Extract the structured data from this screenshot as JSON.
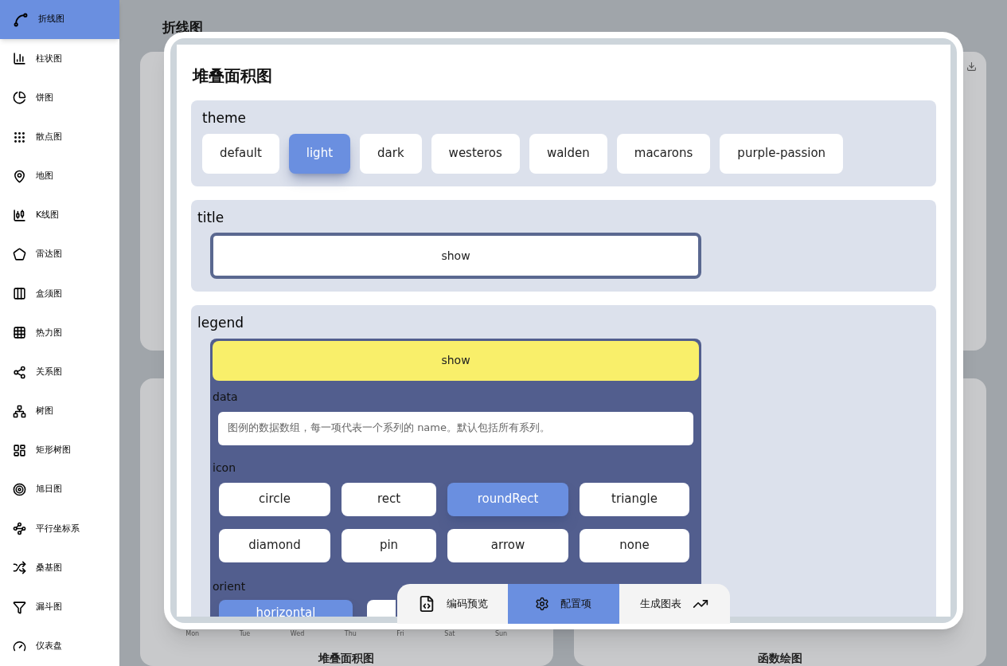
{
  "sidebar": {
    "items": [
      {
        "label": "折线图",
        "selected": true
      },
      {
        "label": "柱状图",
        "selected": false
      },
      {
        "label": "饼图",
        "selected": false
      },
      {
        "label": "散点图",
        "selected": false
      },
      {
        "label": "地图",
        "selected": false
      },
      {
        "label": "K线图",
        "selected": false
      },
      {
        "label": "雷达图",
        "selected": false
      },
      {
        "label": "盒须图",
        "selected": false
      },
      {
        "label": "热力图",
        "selected": false
      },
      {
        "label": "关系图",
        "selected": false
      },
      {
        "label": "树图",
        "selected": false
      },
      {
        "label": "矩形树图",
        "selected": false
      },
      {
        "label": "旭日图",
        "selected": false
      },
      {
        "label": "平行坐标系",
        "selected": false
      },
      {
        "label": "桑基图",
        "selected": false
      },
      {
        "label": "漏斗图",
        "selected": false
      },
      {
        "label": "仪表盘",
        "selected": false
      }
    ]
  },
  "page": {
    "title": "折线图",
    "cards": [
      {
        "title": "堆叠面积图",
        "x_labels": [
          "Mon",
          "Tue",
          "Wed",
          "Thu",
          "Fri",
          "Sat",
          "Sun"
        ]
      },
      {
        "title": "函数绘图"
      }
    ]
  },
  "dialog": {
    "title": "堆叠面积图",
    "theme": {
      "label": "theme",
      "options": [
        {
          "label": "default",
          "selected": false
        },
        {
          "label": "light",
          "selected": true
        },
        {
          "label": "dark",
          "selected": false
        },
        {
          "label": "westeros",
          "selected": false
        },
        {
          "label": "walden",
          "selected": false
        },
        {
          "label": "macarons",
          "selected": false
        },
        {
          "label": "purple-passion",
          "selected": false
        }
      ]
    },
    "title_section": {
      "label": "title",
      "show": {
        "label": "show",
        "on": false
      }
    },
    "legend": {
      "label": "legend",
      "show": {
        "label": "show",
        "on": true
      },
      "data": {
        "label": "data",
        "placeholder": "图例的数据数组，每一项代表一个系列的 name。默认包括所有系列。"
      },
      "icon": {
        "label": "icon",
        "options": [
          {
            "label": "circle",
            "selected": false
          },
          {
            "label": "rect",
            "selected": false
          },
          {
            "label": "roundRect",
            "selected": true
          },
          {
            "label": "triangle",
            "selected": false
          },
          {
            "label": "diamond",
            "selected": false
          },
          {
            "label": "pin",
            "selected": false
          },
          {
            "label": "arrow",
            "selected": false
          },
          {
            "label": "none",
            "selected": false
          }
        ]
      },
      "orient": {
        "label": "orient",
        "options": [
          {
            "label": "horizontal",
            "selected": true
          },
          {
            "selected": false
          }
        ]
      }
    },
    "toolbar": [
      {
        "label": "编码预览",
        "selected": false
      },
      {
        "label": "配置项",
        "selected": true
      },
      {
        "label": "生成图表",
        "selected": false
      }
    ]
  }
}
